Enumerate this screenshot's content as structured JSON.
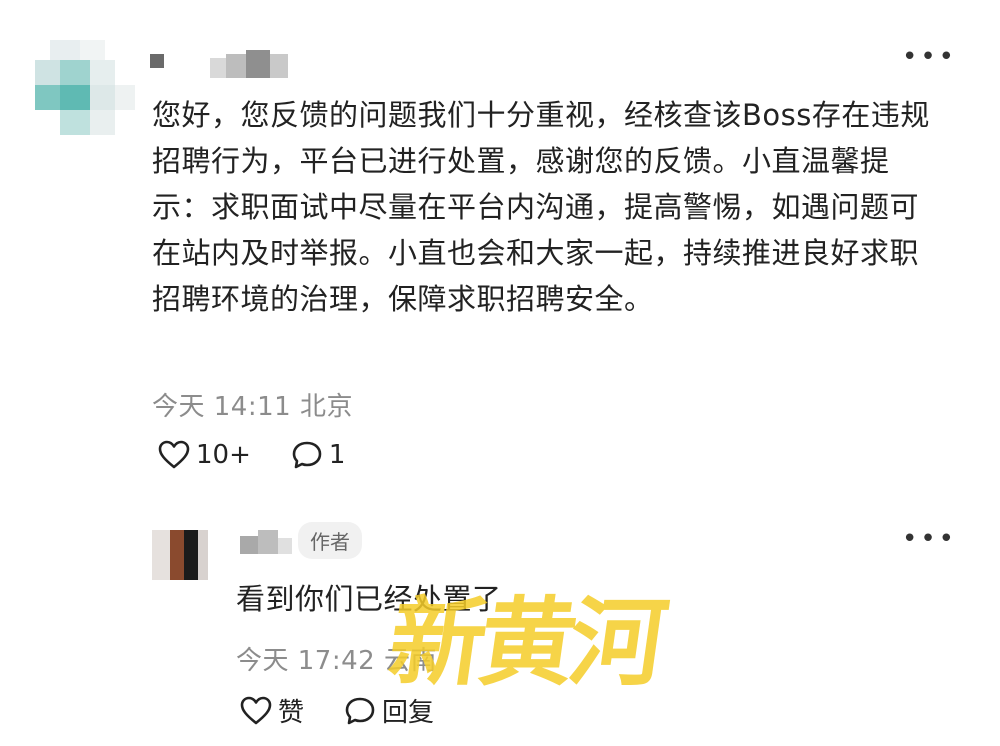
{
  "comment1": {
    "body": "您好，您反馈的问题我们十分重视，经核查该Boss存在违规招聘行为，平台已进行处置，感谢您的反馈。小直温馨提示：求职面试中尽量在平台内沟通，提高警惕，如遇问题可在站内及时举报。小直也会和大家一起，持续推进良好求职招聘环境的治理，保障求职招聘安全。",
    "time": "今天 14:11 北京",
    "like_count": "10+",
    "reply_count": "1",
    "more_icon": "more-dots-icon"
  },
  "comment2": {
    "author_badge": "作者",
    "body": "看到你们已经处置了",
    "time": "今天 17:42 云南",
    "like_label": "赞",
    "reply_label": "回复"
  },
  "watermark": "新黄河",
  "colors": {
    "watermark": "#F5CD28",
    "meta": "#8C8C8C",
    "badge_bg": "#F1F1F1"
  }
}
